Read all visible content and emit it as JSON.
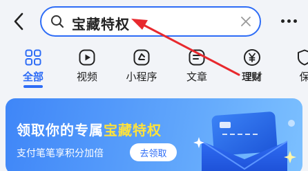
{
  "search": {
    "query": "宝藏特权"
  },
  "annotation": {
    "label": "理财"
  },
  "tabs": [
    {
      "label": "全部",
      "icon": "grid-icon",
      "active": true
    },
    {
      "label": "视频",
      "icon": "play-icon",
      "active": false
    },
    {
      "label": "小程序",
      "icon": "mini-program-icon",
      "active": false
    },
    {
      "label": "文章",
      "icon": "article-icon",
      "active": false
    },
    {
      "label": "理财",
      "icon": "yuan-icon",
      "active": false
    },
    {
      "label": "保",
      "icon": "shield-icon",
      "active": false
    }
  ],
  "banner": {
    "title_prefix": "领取你的专属",
    "title_highlight": "宝藏特权",
    "subtitle": "支付笔笔享积分加倍",
    "button_label": "去领取"
  },
  "colors": {
    "accent": "#2d6cf6",
    "annotation_red": "#e8292e",
    "highlight_yellow": "#ffe23b"
  }
}
